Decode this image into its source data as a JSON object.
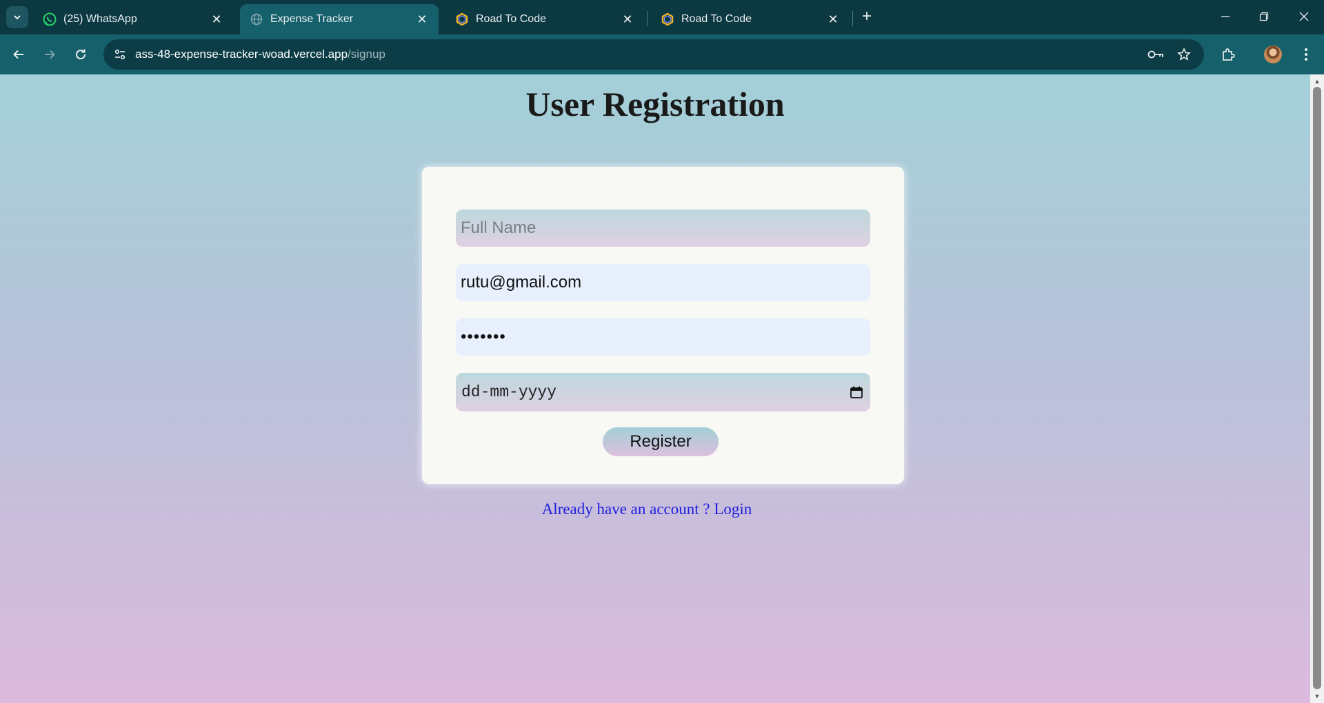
{
  "browser": {
    "tabs": [
      {
        "title": "(25) WhatsApp",
        "favicon": "whatsapp-icon",
        "active": false
      },
      {
        "title": "Expense Tracker",
        "favicon": "globe-icon",
        "active": true
      },
      {
        "title": "Road To Code",
        "favicon": "hexagon-logo-icon",
        "active": false
      },
      {
        "title": "Road To Code",
        "favicon": "hexagon-logo-icon",
        "active": false
      }
    ],
    "url_host": "ass-48-expense-tracker-woad.vercel.app",
    "url_path": "/signup",
    "colors": {
      "tabstrip": "#0c3841",
      "toolbar": "#16606b",
      "omnibox": "#0c3d46"
    }
  },
  "page": {
    "title": "User Registration",
    "form": {
      "name_placeholder": "Full Name",
      "email_value": "rutu@gmail.com",
      "password_value": "•••••••",
      "date_placeholder": "dd-mm-yyyy",
      "register_label": "Register"
    },
    "login_link": "Already have an account ? Login",
    "colors": {
      "gradient_top": "#a3d0d8",
      "gradient_bottom": "#dcbadd",
      "link": "#1d1de0",
      "card": "#f8f8f4"
    }
  }
}
